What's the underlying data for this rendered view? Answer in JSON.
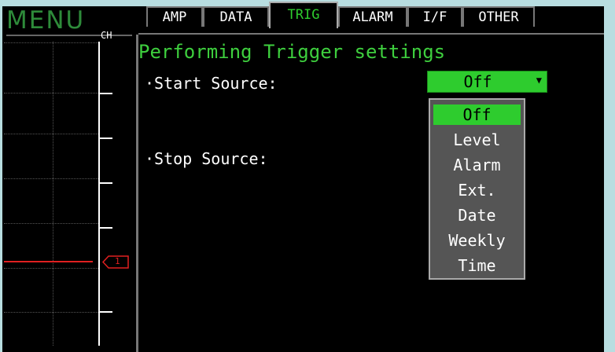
{
  "menu_title": "MENU",
  "channel_header": "CH",
  "channel_marker": "1",
  "tabs": [
    {
      "label": "AMP"
    },
    {
      "label": "DATA"
    },
    {
      "label": "TRIG"
    },
    {
      "label": "ALARM"
    },
    {
      "label": "I/F"
    },
    {
      "label": "OTHER"
    }
  ],
  "active_tab": "TRIG",
  "heading": "Performing Trigger settings",
  "start_source": {
    "label": "·Start Source:",
    "value": "Off"
  },
  "stop_source": {
    "label": "·Stop Source:"
  },
  "dropdown_options": [
    "Off",
    "Level",
    "Alarm",
    "Ext.",
    "Date",
    "Weekly",
    "Time"
  ],
  "dropdown_selected": "Off",
  "colors": {
    "accent_green": "#2ecc2e",
    "trace_red": "#e02020",
    "frame": "#b8dde0"
  }
}
